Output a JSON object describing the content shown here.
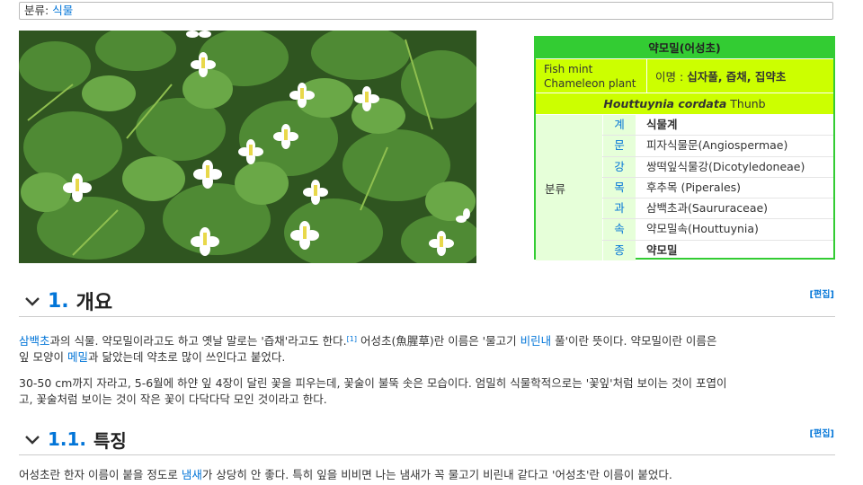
{
  "category": {
    "label": "분류: ",
    "link": "식물"
  },
  "infobox": {
    "title": "약모밀(어성초)",
    "english_name_line1": "Fish mint",
    "english_name_line2": "Chameleon plant",
    "alias_label": "이명 :",
    "alias_value": "십자풀, 즙채, 집약초",
    "scientific_name": "Houttuynia cordata",
    "author": " Thunb",
    "classification_label": "분류",
    "ranks": [
      {
        "rank": "계",
        "value": "식물계"
      },
      {
        "rank": "문",
        "value": "피자식물문(Angiospermae)"
      },
      {
        "rank": "강",
        "value": "쌍떡잎식물강(Dicotyledoneae)"
      },
      {
        "rank": "목",
        "value": "후추목 (Piperales)"
      },
      {
        "rank": "과",
        "value": "삼백초과(Saururaceae)"
      },
      {
        "rank": "속",
        "value": "약모밀속(Houttuynia)"
      },
      {
        "rank": "종",
        "value": "약모밀"
      }
    ],
    "colors": {
      "border": "#33cc33",
      "header": "#33cc33",
      "highlight": "#ccff00",
      "rank_bg": "#e6ffd9"
    }
  },
  "section1": {
    "number": "1.",
    "title": "개요",
    "edit": "[편집]",
    "p1": {
      "link1": "삼백초",
      "t1": "과의 식물. 약모밀이라고도 하고 옛날 말로는 '즙채'라고도 한다.",
      "ref": "[1]",
      "t2": " 어성초(魚腥草)란 이름은 '물고기 ",
      "link2": "비린내",
      "t3": " 풀'이란 뜻이다. 약모밀이란 이름은",
      "t4": "잎 모양이 ",
      "link3": "메밀",
      "t5": "과 닮았는데 약초로 많이 쓰인다고 붙었다."
    },
    "p2_line1": "30-50 cm까지 자라고, 5-6월에 하얀 잎 4장이 달린 꽃을 피우는데, 꽃술이 불뚝 솟은 모습이다. 엄밀히 식물학적으로는 '꽃잎'처럼 보이는 것이 포엽이",
    "p2_line2": "고, 꽃술처럼 보이는 것이 작은 꽃이 다닥다닥 모인 것이라고 한다."
  },
  "section11": {
    "number": "1.1.",
    "title": "특징",
    "edit": "[편집]",
    "t1": "어성초란 한자 이름이 붙을 정도로 ",
    "link1": "냄새",
    "t2": "가 상당히 안 좋다. 특히 잎을 비비면 나는 냄새가 꼭 물고기 비린내 같다고 '어성초'란 이름이 붙었다."
  }
}
